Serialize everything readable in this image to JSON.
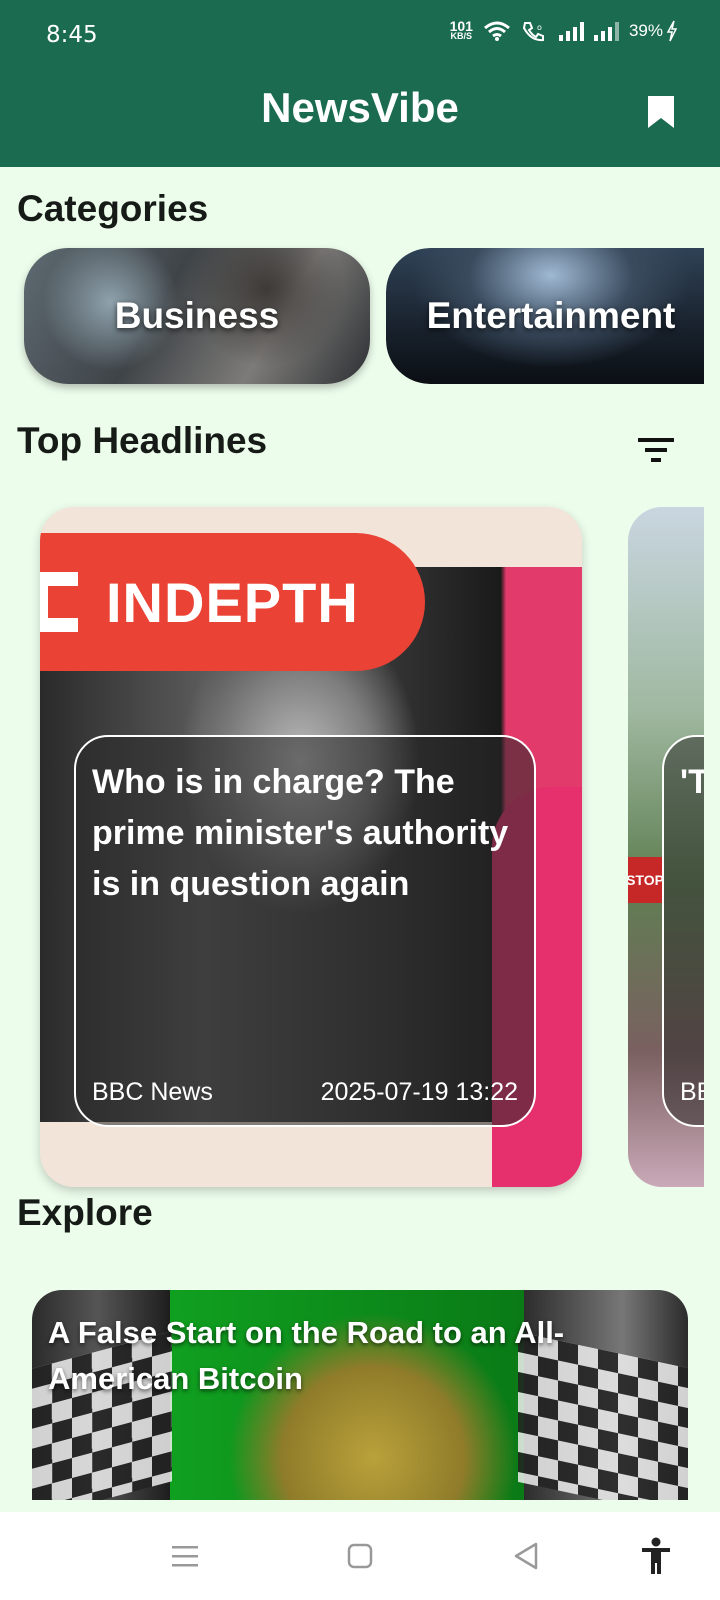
{
  "status_bar": {
    "time": "8:45",
    "net_speed_value": "101",
    "net_speed_unit": "KB/S",
    "battery": "39%"
  },
  "app_bar": {
    "title": "NewsVibe",
    "bookmark_icon": "bookmark-icon"
  },
  "categories": {
    "title": "Categories",
    "items": [
      {
        "label": "Business"
      },
      {
        "label": "Entertainment"
      }
    ]
  },
  "top_headlines": {
    "title": "Top Headlines",
    "cards": [
      {
        "banner": "INDEPTH",
        "title": "Who is in charge? The prime minister's authority is in question again",
        "source": "BBC News",
        "published": "2025-07-19 13:22"
      },
      {
        "title": "'T lo de ba",
        "source": "BE",
        "sign": "STOP"
      }
    ]
  },
  "explore": {
    "title": "Explore",
    "card": {
      "title": "A False Start on the Road to an All-American Bitcoin"
    }
  },
  "colors": {
    "primary": "#1b6b50",
    "background": "#edfdec",
    "banner_red": "#ea4335"
  }
}
